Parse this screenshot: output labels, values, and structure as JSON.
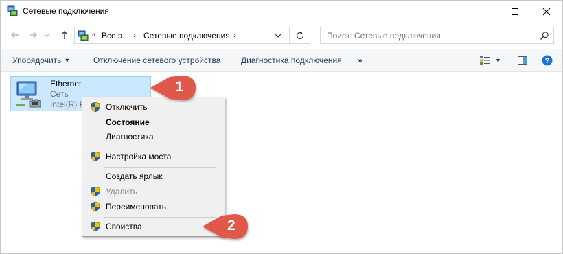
{
  "window": {
    "title": "Сетевые подключения"
  },
  "address_bar": {
    "overflow": "«",
    "segment_1": "Все э...",
    "segment_2": "Сетевые подключения",
    "separator": "›"
  },
  "search": {
    "placeholder": "Поиск: Сетевые подключения"
  },
  "command_bar": {
    "organize": "Упорядочить",
    "organize_arrow": "▼",
    "disable_device": "Отключение сетевого устройства",
    "diagnose": "Диагностика подключения",
    "more": "»",
    "view_arrow": "▼"
  },
  "connection": {
    "name": "Ethernet",
    "type": "Сеть",
    "adapter": "Intel(R) P"
  },
  "context_menu": {
    "items": [
      {
        "label": "Отключить",
        "shield": true
      },
      {
        "label": "Состояние",
        "bold": true
      },
      {
        "label": "Диагностика"
      },
      {
        "label": "Настройка моста",
        "shield": true
      },
      {
        "label": "Создать ярлык"
      },
      {
        "label": "Удалить",
        "shield": true,
        "disabled": true
      },
      {
        "label": "Переименовать",
        "shield": true
      },
      {
        "label": "Свойства",
        "shield": true
      }
    ]
  },
  "callouts": {
    "first": "1",
    "second": "2",
    "color": "#e0584a"
  },
  "colors": {
    "selection_bg": "#cce8ff",
    "selection_border": "#99d1ff",
    "help_blue": "#1a73d9"
  }
}
